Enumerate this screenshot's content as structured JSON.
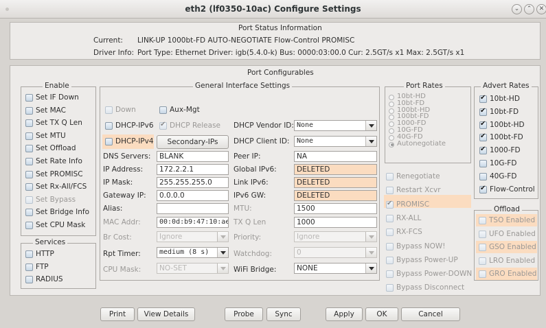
{
  "window": {
    "title": "eth2  (lf0350-10ac) Configure Settings",
    "min_icon": "⌄",
    "max_icon": "⌃",
    "close_icon": "✕"
  },
  "status": {
    "header": "Port Status Information",
    "current_label": "Current:",
    "current_value": "LINK-UP 1000bt-FD AUTO-NEGOTIATE Flow-Control PROMISC",
    "driver_label": "Driver Info:",
    "driver_value": "Port Type: Ethernet   Driver: igb(5.4.0-k)  Bus: 0000:03:00.0  Cur: 2.5GT/s x1  Max: 2.5GT/s x1"
  },
  "configurables": {
    "header": "Port Configurables"
  },
  "enable": {
    "legend": "Enable",
    "items": [
      {
        "label": "Set IF Down",
        "enabled": true
      },
      {
        "label": "Set MAC",
        "enabled": true
      },
      {
        "label": "Set TX Q Len",
        "enabled": true
      },
      {
        "label": "Set MTU",
        "enabled": true
      },
      {
        "label": "Set Offload",
        "enabled": true
      },
      {
        "label": "Set Rate Info",
        "enabled": true
      },
      {
        "label": "Set PROMISC",
        "enabled": true
      },
      {
        "label": "Set Rx-All/FCS",
        "enabled": true
      },
      {
        "label": "Set Bypass",
        "enabled": false
      },
      {
        "label": "Set Bridge Info",
        "enabled": true
      },
      {
        "label": "Set CPU Mask",
        "enabled": true
      }
    ]
  },
  "services": {
    "legend": "Services",
    "items": [
      "HTTP",
      "FTP",
      "RADIUS"
    ]
  },
  "general": {
    "legend": "General Interface Settings",
    "down": "Down",
    "aux_mgt": "Aux-Mgt",
    "dhcp_ipv6": "DHCP-IPv6",
    "dhcp_release": "DHCP Release",
    "dhcp_ipv4": "DHCP-IPv4",
    "secondary_ips": "Secondary-IPs",
    "dhcp_vendor_label": "DHCP Vendor ID:",
    "dhcp_vendor_value": "None",
    "dhcp_client_label": "DHCP Client ID:",
    "dhcp_client_value": "None",
    "dns_label": "DNS Servers:",
    "dns_value": "BLANK",
    "peer_ip_label": "Peer IP:",
    "peer_ip_value": "NA",
    "ip_label": "IP Address:",
    "ip_value": "172.2.2.1",
    "global_ipv6_label": "Global IPv6:",
    "global_ipv6_value": "DELETED",
    "mask_label": "IP Mask:",
    "mask_value": "255.255.255.0",
    "link_ipv6_label": "Link IPv6:",
    "link_ipv6_value": "DELETED",
    "gateway_label": "Gateway IP:",
    "gateway_value": "0.0.0.0",
    "ipv6_gw_label": "IPv6 GW:",
    "ipv6_gw_value": "DELETED",
    "alias_label": "Alias:",
    "alias_value": "",
    "mtu_label": "MTU:",
    "mtu_value": "1500",
    "mac_label": "MAC Addr:",
    "mac_value": "00:0d:b9:47:10:ae",
    "txq_label": "TX Q Len",
    "txq_value": "1000",
    "brcost_label": "Br Cost:",
    "brcost_value": "Ignore",
    "priority_label": "Priority:",
    "priority_value": "Ignore",
    "rpt_label": "Rpt Timer:",
    "rpt_value": "medium  (8 s)",
    "watchdog_label": "Watchdog:",
    "watchdog_value": "0",
    "cpumask_label": "CPU Mask:",
    "cpumask_value": "NO-SET",
    "wifi_bridge_label": "WiFi Bridge:",
    "wifi_bridge_value": "NONE"
  },
  "port_rates": {
    "legend": "Port Rates",
    "items": [
      "10bt-HD",
      "10bt-FD",
      "100bt-HD",
      "100bt-FD",
      "1000-FD",
      "10G-FD",
      "40G-FD",
      "Autonegotiate"
    ]
  },
  "misc_checks": [
    "Renegotiate",
    "Restart Xcvr",
    "PROMISC",
    "RX-ALL",
    "RX-FCS",
    "Bypass NOW!",
    "Bypass Power-UP",
    "Bypass Power-DOWN",
    "Bypass Disconnect"
  ],
  "advert_rates": {
    "legend": "Advert Rates",
    "items": [
      {
        "label": "10bt-HD",
        "checked": true
      },
      {
        "label": "10bt-FD",
        "checked": true
      },
      {
        "label": "100bt-HD",
        "checked": true
      },
      {
        "label": "100bt-FD",
        "checked": true
      },
      {
        "label": "1000-FD",
        "checked": true
      },
      {
        "label": "10G-FD",
        "checked": false
      },
      {
        "label": "40G-FD",
        "checked": false
      },
      {
        "label": "Flow-Control",
        "checked": true
      }
    ]
  },
  "offload": {
    "legend": "Offload",
    "items": [
      "TSO Enabled",
      "UFO Enabled",
      "GSO Enabled",
      "LRO Enabled",
      "GRO Enabled"
    ]
  },
  "buttons": {
    "print": "Print",
    "view_details": "View Details",
    "probe": "Probe",
    "sync": "Sync",
    "apply": "Apply",
    "ok": "OK",
    "cancel": "Cancel"
  },
  "colors": {
    "highlight": "#fbdcc0",
    "window_bg": "#d7d4d0",
    "panel_bg": "#edebe9"
  }
}
